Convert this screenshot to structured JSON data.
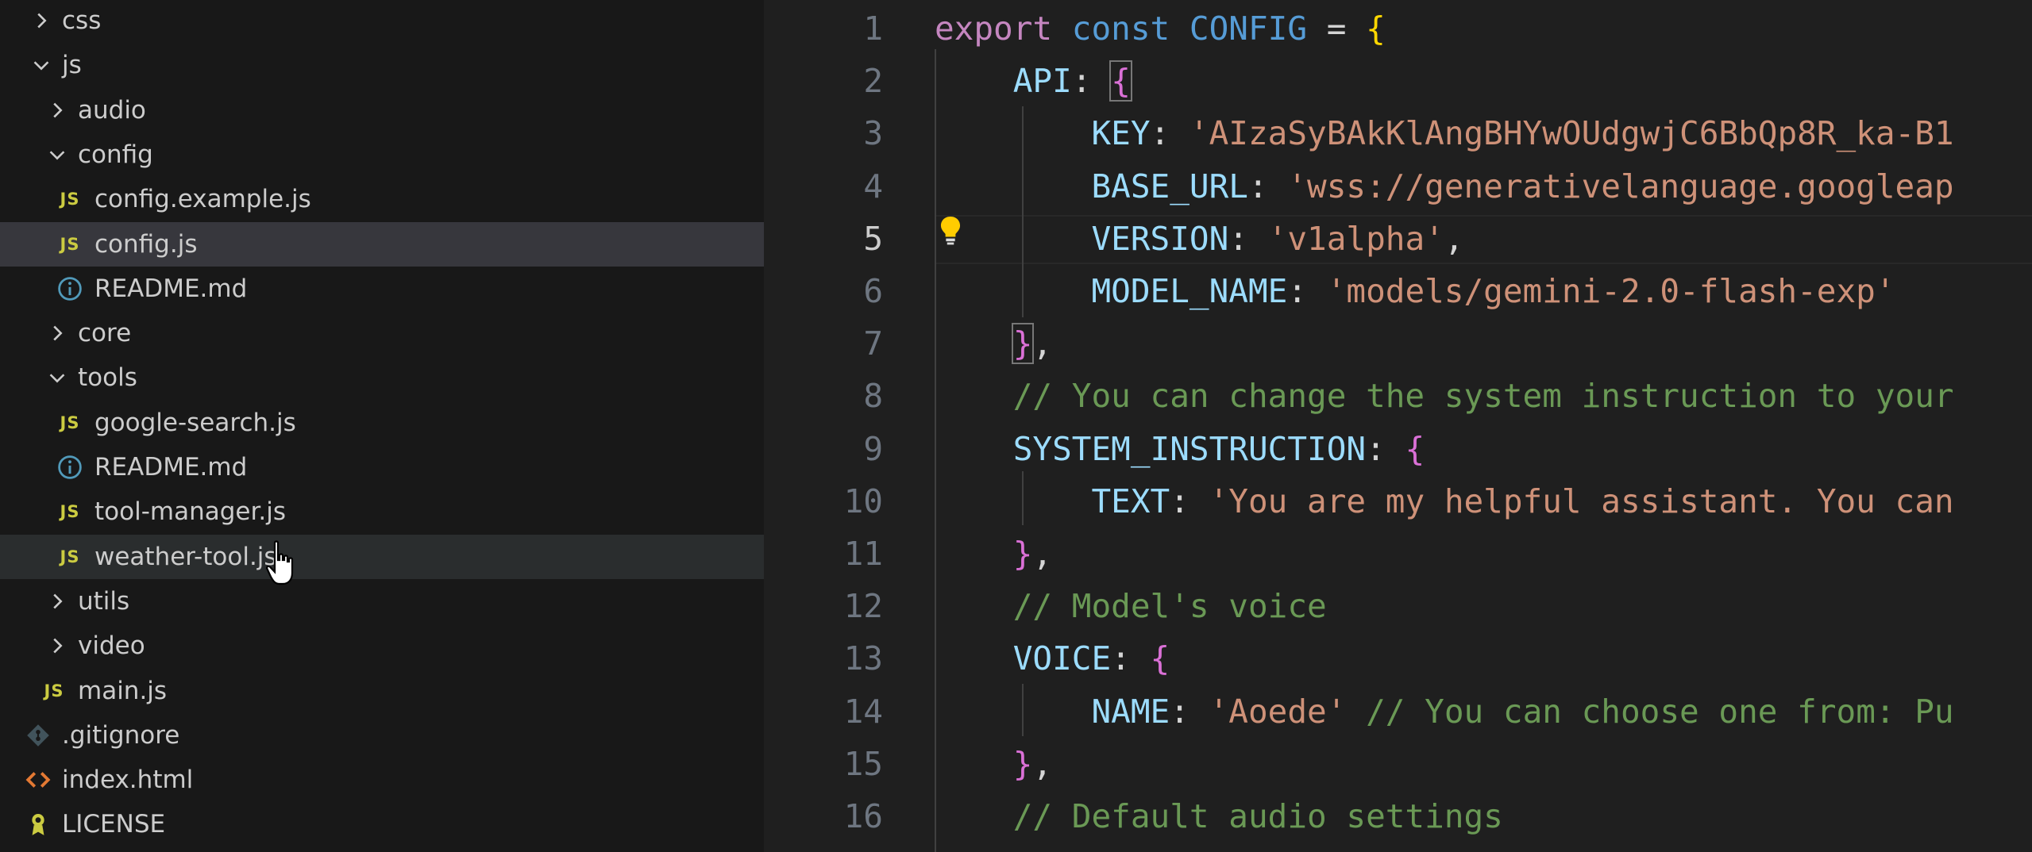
{
  "explorer": {
    "items": [
      {
        "label": "css",
        "type": "folder",
        "expanded": false,
        "depth": 1
      },
      {
        "label": "js",
        "type": "folder",
        "expanded": true,
        "depth": 1
      },
      {
        "label": "audio",
        "type": "folder",
        "expanded": false,
        "depth": 2
      },
      {
        "label": "config",
        "type": "folder",
        "expanded": true,
        "depth": 2
      },
      {
        "label": "config.example.js",
        "type": "js",
        "depth": 3
      },
      {
        "label": "config.js",
        "type": "js",
        "depth": 3,
        "selected": true
      },
      {
        "label": "README.md",
        "type": "info",
        "depth": 3
      },
      {
        "label": "core",
        "type": "folder",
        "expanded": false,
        "depth": 2
      },
      {
        "label": "tools",
        "type": "folder",
        "expanded": true,
        "depth": 2
      },
      {
        "label": "google-search.js",
        "type": "js",
        "depth": 3
      },
      {
        "label": "README.md",
        "type": "info",
        "depth": 3
      },
      {
        "label": "tool-manager.js",
        "type": "js",
        "depth": 3
      },
      {
        "label": "weather-tool.js",
        "type": "js",
        "depth": 3,
        "hovered": true
      },
      {
        "label": "utils",
        "type": "folder",
        "expanded": false,
        "depth": 2
      },
      {
        "label": "video",
        "type": "folder",
        "expanded": false,
        "depth": 2
      },
      {
        "label": "main.js",
        "type": "js",
        "depth": 2
      },
      {
        "label": ".gitignore",
        "type": "git",
        "depth": 1
      },
      {
        "label": "index.html",
        "type": "html",
        "depth": 1
      },
      {
        "label": "LICENSE",
        "type": "license",
        "depth": 1
      }
    ],
    "js_icon_text": "JS"
  },
  "editor": {
    "active_line": 5,
    "line_numbers": [
      "1",
      "2",
      "3",
      "4",
      "5",
      "6",
      "7",
      "8",
      "9",
      "10",
      "11",
      "12",
      "13",
      "14",
      "15",
      "16"
    ],
    "lines": [
      [
        {
          "t": "export",
          "c": "kw2"
        },
        {
          "t": " "
        },
        {
          "t": "const",
          "c": "kw"
        },
        {
          "t": " "
        },
        {
          "t": "CONFIG",
          "c": "kw"
        },
        {
          "t": " = "
        },
        {
          "t": "{",
          "c": "br1"
        }
      ],
      [
        {
          "t": "    "
        },
        {
          "t": "API",
          "c": "prop"
        },
        {
          "t": ": "
        },
        {
          "t": "{",
          "c": "br2 br-match"
        }
      ],
      [
        {
          "t": "        "
        },
        {
          "t": "KEY",
          "c": "prop"
        },
        {
          "t": ": "
        },
        {
          "t": "'AIzaSyBAkKlAngBHYwOUdgwjC6BbQp8R_ka-B1",
          "c": "str"
        }
      ],
      [
        {
          "t": "        "
        },
        {
          "t": "BASE_URL",
          "c": "prop"
        },
        {
          "t": ": "
        },
        {
          "t": "'wss://generativelanguage.googleap",
          "c": "str"
        }
      ],
      [
        {
          "t": "        "
        },
        {
          "t": "VERSION",
          "c": "prop"
        },
        {
          "t": ": "
        },
        {
          "t": "'v1alpha'",
          "c": "str"
        },
        {
          "t": ","
        }
      ],
      [
        {
          "t": "        "
        },
        {
          "t": "MODEL_NAME",
          "c": "prop"
        },
        {
          "t": ": "
        },
        {
          "t": "'models/gemini-2.0-flash-exp'",
          "c": "str"
        }
      ],
      [
        {
          "t": "    "
        },
        {
          "t": "}",
          "c": "br2 br-match"
        },
        {
          "t": ","
        }
      ],
      [
        {
          "t": "    "
        },
        {
          "t": "// You can change the system instruction to your",
          "c": "cmt"
        }
      ],
      [
        {
          "t": "    "
        },
        {
          "t": "SYSTEM_INSTRUCTION",
          "c": "prop"
        },
        {
          "t": ": "
        },
        {
          "t": "{",
          "c": "br2"
        }
      ],
      [
        {
          "t": "        "
        },
        {
          "t": "TEXT",
          "c": "prop"
        },
        {
          "t": ": "
        },
        {
          "t": "'You are my helpful assistant. You can",
          "c": "str"
        }
      ],
      [
        {
          "t": "    "
        },
        {
          "t": "}",
          "c": "br2"
        },
        {
          "t": ","
        }
      ],
      [
        {
          "t": "    "
        },
        {
          "t": "// Model's voice",
          "c": "cmt"
        }
      ],
      [
        {
          "t": "    "
        },
        {
          "t": "VOICE",
          "c": "prop"
        },
        {
          "t": ": "
        },
        {
          "t": "{",
          "c": "br2"
        }
      ],
      [
        {
          "t": "        "
        },
        {
          "t": "NAME",
          "c": "prop"
        },
        {
          "t": ": "
        },
        {
          "t": "'Aoede'",
          "c": "str"
        },
        {
          "t": " "
        },
        {
          "t": "// You can choose one from: Pu",
          "c": "cmt"
        }
      ],
      [
        {
          "t": "    "
        },
        {
          "t": "}",
          "c": "br2"
        },
        {
          "t": ","
        }
      ],
      [
        {
          "t": "    "
        },
        {
          "t": "// Default audio settings",
          "c": "cmt"
        }
      ]
    ]
  },
  "colors": {
    "sidebar_bg": "#181818",
    "editor_bg": "#1f1f1f",
    "selected_row": "#37373d",
    "js_icon": "#cbcb41"
  }
}
